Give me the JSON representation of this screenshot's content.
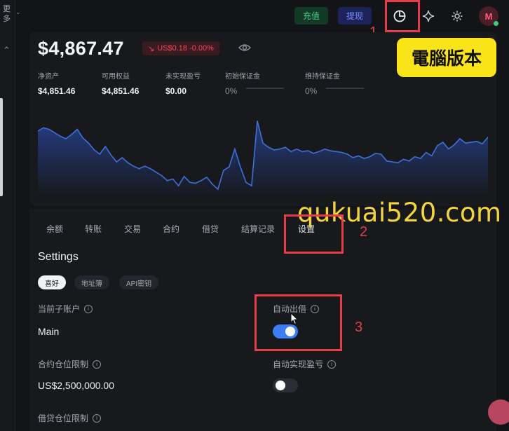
{
  "sidebar": {
    "more_label": "更多"
  },
  "header": {
    "deposit_label": "充值",
    "withdraw_label": "提现",
    "avatar_initial": "M"
  },
  "annotations": {
    "badge_text": "電腦版本",
    "watermark": "qukuai520.com",
    "markers": [
      "1",
      "2",
      "3"
    ]
  },
  "account": {
    "total_balance": "$4,867.47",
    "change": "US$0.18 -0.00%",
    "change_arrow": "↘",
    "stats": [
      {
        "label": "净资产",
        "value": "$4,851.46"
      },
      {
        "label": "可用权益",
        "value": "$4,851.46"
      },
      {
        "label": "未实现盈亏",
        "value": "$0.00"
      },
      {
        "label": "初始保证金",
        "value": "0%"
      },
      {
        "label": "维持保证金",
        "value": "0%"
      }
    ]
  },
  "chart_data": {
    "type": "area",
    "title": "",
    "series": [
      {
        "values": [
          0.68,
          0.72,
          0.7,
          0.66,
          0.62,
          0.59,
          0.64,
          0.7,
          0.6,
          0.54,
          0.46,
          0.41,
          0.5,
          0.4,
          0.32,
          0.37,
          0.31,
          0.27,
          0.24,
          0.27,
          0.24,
          0.2,
          0.16,
          0.1,
          0.12,
          0.04,
          0.15,
          0.08,
          0.07,
          0.1,
          0.14,
          0.06,
          0.0,
          0.22,
          0.26,
          0.47,
          0.26,
          0.08,
          0.04,
          0.8,
          0.54,
          0.49,
          0.46,
          0.47,
          0.49,
          0.44,
          0.47,
          0.44,
          0.45,
          0.42,
          0.44,
          0.47,
          0.45,
          0.44,
          0.43,
          0.41,
          0.37,
          0.39,
          0.36,
          0.38,
          0.42,
          0.41,
          0.33,
          0.32,
          0.31,
          0.35,
          0.33,
          0.38,
          0.36,
          0.43,
          0.39,
          0.51,
          0.55,
          0.47,
          0.52,
          0.59,
          0.54,
          0.55,
          0.56,
          0.53,
          0.61
        ]
      }
    ],
    "color": "#3f6fd8",
    "fill_top": "#253d82",
    "fill_bottom": "#17191d"
  },
  "tabs": [
    "余额",
    "转账",
    "交易",
    "合约",
    "借贷",
    "结算记录",
    "设置"
  ],
  "active_tab": "设置",
  "settings": {
    "title": "Settings",
    "subtabs": [
      "喜好",
      "地址簿",
      "API密钥"
    ],
    "current_subaccount_label": "当前子账户",
    "current_subaccount_value": "Main",
    "auto_lend_label": "自动出借",
    "auto_lend": true,
    "contract_limit_label": "合约仓位限制",
    "contract_limit_value": "US$2,500,000.00",
    "auto_pnl_label": "自动实现盈亏",
    "auto_pnl": false,
    "borrow_limit_label": "借贷仓位限制"
  },
  "colors": {
    "accent_blue": "#3e7bf7",
    "deposit_green": "#4fd18a",
    "negative_red": "#f0485b",
    "highlight_red": "#e53d49",
    "badge_yellow": "#f9e419"
  }
}
